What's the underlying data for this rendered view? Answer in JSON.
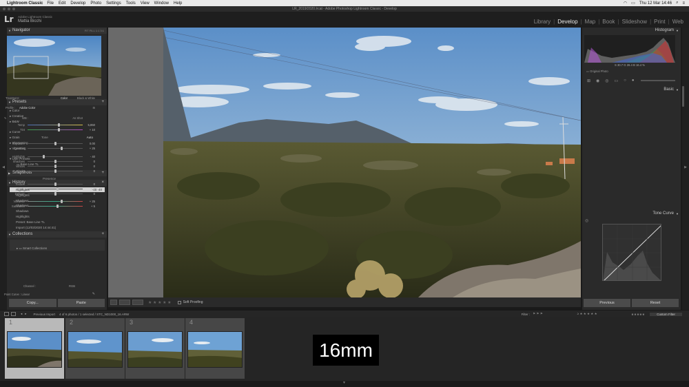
{
  "menubar": {
    "app": "Lightroom Classic",
    "items": [
      "File",
      "Edit",
      "Develop",
      "Photo",
      "Settings",
      "Tools",
      "View",
      "Window",
      "Help"
    ],
    "clock": "Thu 12 Mar  14:46"
  },
  "window_title": "LR_2019/2020.lrcat - Adobe Photoshop Lightroom Classic - Develop",
  "identity": {
    "logo": "Lr",
    "line1": "Adobe Lightroom Classic",
    "line2": "Mattia Bicchi"
  },
  "modules": [
    "Library",
    "Develop",
    "Map",
    "Book",
    "Slideshow",
    "Print",
    "Web"
  ],
  "active_module": "Develop",
  "left": {
    "navigator": {
      "title": "Navigator",
      "zoom_options": "FIT  FILL  1:1  3:1"
    },
    "presets": {
      "title": "Presets",
      "items": [
        "Color",
        "Creative",
        "B&W",
        "Curve",
        "Grain",
        "Sharpening",
        "Vignetting",
        "User Presets",
        "Base Line TL"
      ]
    },
    "snapshots": {
      "title": "Snapshots"
    },
    "history": {
      "title": "History",
      "items": [
        {
          "label": "Highlights",
          "value": "-40  -40"
        },
        {
          "label": "Highlights",
          "value": ""
        },
        {
          "label": "Shadows",
          "value": ""
        },
        {
          "label": "Shadows",
          "value": ""
        },
        {
          "label": "Shadows",
          "value": ""
        },
        {
          "label": "Highlights",
          "value": ""
        },
        {
          "label": "Preset: Base Line TL",
          "value": ""
        },
        {
          "label": "Import (12/03/2020 14:44:41)",
          "value": ""
        }
      ]
    },
    "collections": {
      "title": "Collections",
      "items": [
        "Smart Collections"
      ]
    },
    "copy_label": "Copy...",
    "paste_label": "Paste"
  },
  "toolbar": {
    "soft_proofing": "Soft Proofing",
    "stars": "★ ★ ★ ★ ★"
  },
  "right": {
    "histogram": {
      "title": "Histogram",
      "info": "S  30.7   G  26.4   B  16.4 %",
      "original_photo": "Original Photo"
    },
    "basic": {
      "title": "Basic",
      "treatment_label": "Treatment :",
      "treatment_color": "Color",
      "treatment_bw": "Black & White",
      "profile_label": "Profile :",
      "profile_value": "Adobe Color",
      "wb_label": "WB :",
      "wb_value": "As Shot",
      "tone_label": "Tone",
      "tone_auto": "Auto",
      "presence_label": "Presence",
      "sliders": [
        {
          "label": "Temp",
          "value": "5,850",
          "pos": 0.55
        },
        {
          "label": "Tint",
          "value": "+ 10",
          "pos": 0.55
        },
        {
          "label": "Exposure",
          "value": "0.00",
          "pos": 0.5
        },
        {
          "label": "Contrast",
          "value": "+ 25",
          "pos": 0.62
        },
        {
          "label": "Highlights",
          "value": "- 40",
          "pos": 0.3
        },
        {
          "label": "Shadows",
          "value": "0",
          "pos": 0.5
        },
        {
          "label": "Whites",
          "value": "0",
          "pos": 0.5
        },
        {
          "label": "Blacks",
          "value": "0",
          "pos": 0.5
        },
        {
          "label": "Texture",
          "value": "0",
          "pos": 0.5
        },
        {
          "label": "Clarity",
          "value": "+ 5",
          "pos": 0.53
        },
        {
          "label": "Dehaze",
          "value": "0",
          "pos": 0.5
        },
        {
          "label": "Vibrance",
          "value": "+ 25",
          "pos": 0.62
        },
        {
          "label": "Saturation",
          "value": "+ 5",
          "pos": 0.53
        }
      ]
    },
    "tone_curve": {
      "title": "Tone Curve",
      "channel_label": "Channel :",
      "channel_value": "RGB",
      "point_curve": "Point Curve : Linear"
    },
    "previous_label": "Previous",
    "reset_label": "Reset"
  },
  "filmstrip": {
    "source": "Previous Import",
    "status": "4 of 6 photos / 1 selected / STC_ND1000_16.ARW",
    "filter_label": "Filter :",
    "filter_value": "Custom Filter",
    "cells": [
      {
        "num": "1",
        "selected": true
      },
      {
        "num": "2",
        "selected": false
      },
      {
        "num": "3",
        "selected": false
      },
      {
        "num": "4",
        "selected": false
      }
    ]
  },
  "overlay_text": "16mm",
  "colors": {
    "accent_sel": "#d4d4d4",
    "panel_bg": "#2a2a2a",
    "sky_top": "#5b8fc8",
    "sky_bottom": "#a9c5dd"
  }
}
